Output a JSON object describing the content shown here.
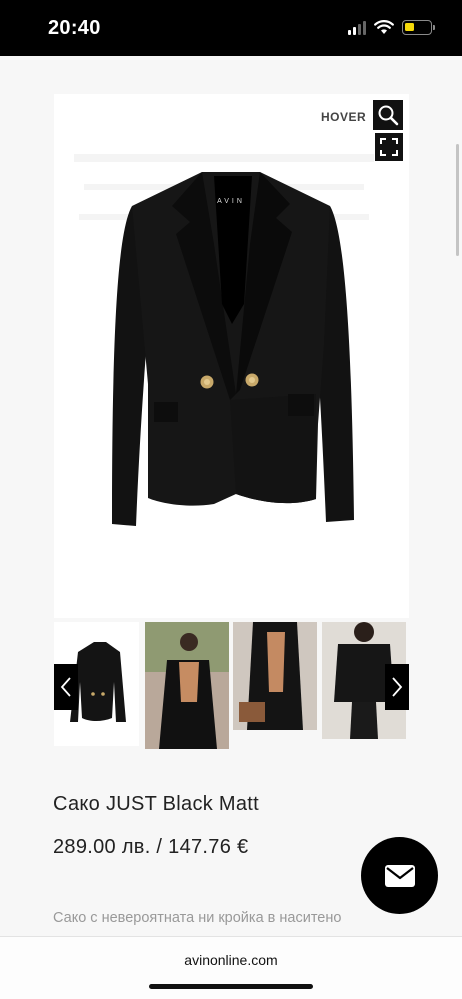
{
  "status_bar": {
    "time": "20:40",
    "battery_color": "#f5d90a"
  },
  "gallery": {
    "hover_label": "HOVER",
    "brand_label": "AVIN",
    "zoom_icon": "search-icon",
    "expand_icon": "expand-icon",
    "prev_icon": "chevron-left-icon",
    "next_icon": "chevron-right-icon",
    "thumbnail_count": 4
  },
  "product": {
    "title": "Сако JUST Black Matt",
    "price": "289.00 лв. / 147.76 €",
    "description": "Сако с невероятната ни кройка в наситено"
  },
  "fab": {
    "icon": "mail-icon"
  },
  "browser": {
    "url": "avinonline.com"
  }
}
